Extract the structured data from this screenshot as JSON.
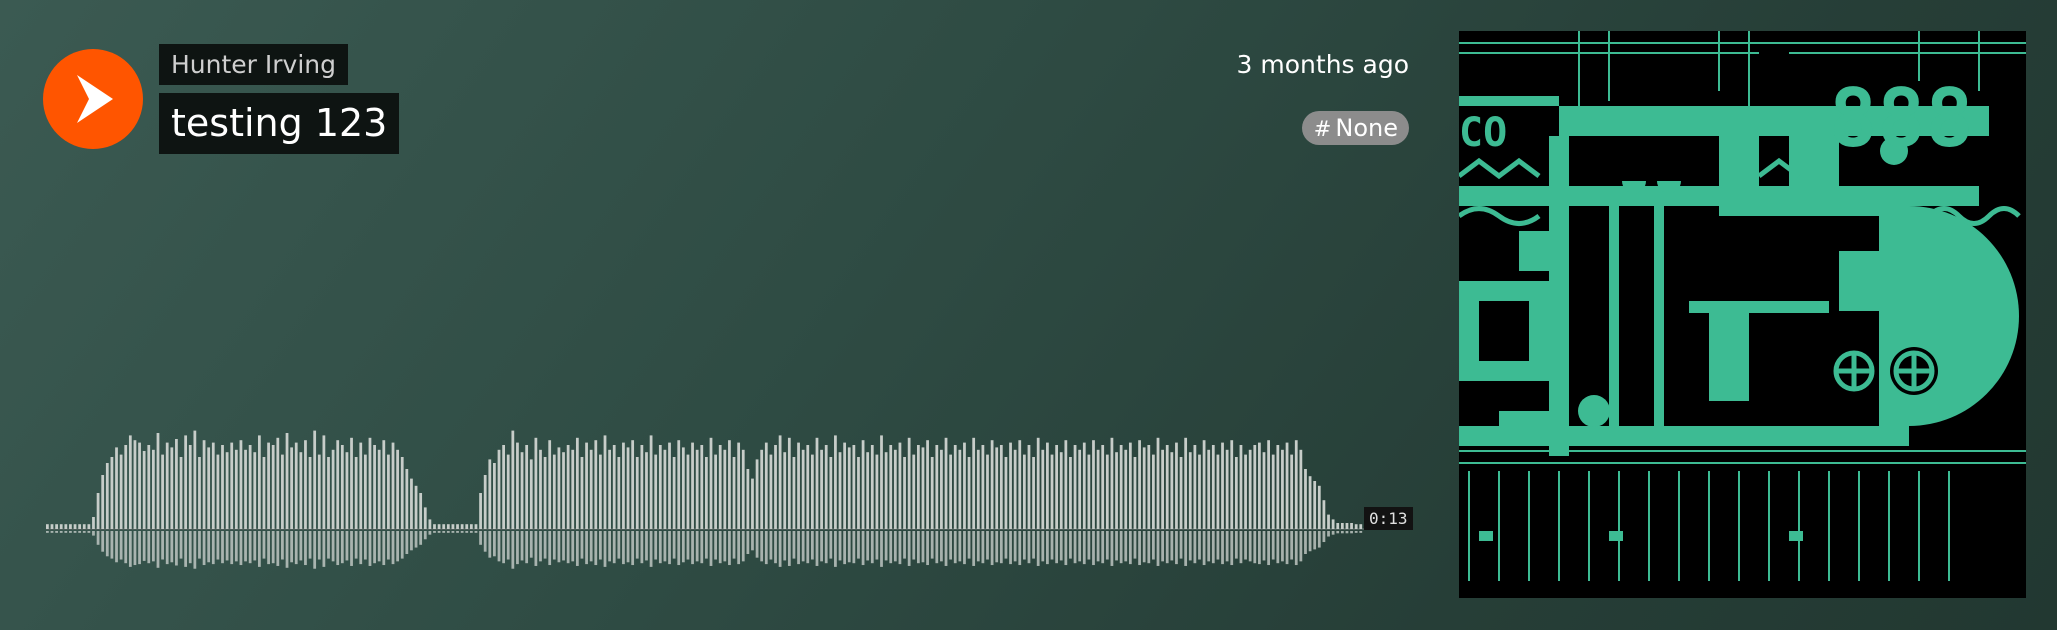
{
  "artist": {
    "name": "Hunter Irving"
  },
  "track": {
    "title": "testing 123",
    "posted": "3 months ago",
    "tag": "None",
    "duration": "0:13"
  },
  "colors": {
    "accent": "#ff5500",
    "waveform": "#c7cdc9",
    "artwork_green": "#3dbb93"
  },
  "icons": {
    "play": "play-icon",
    "tag": "hash-icon"
  },
  "waveform": {
    "played_fraction": 0,
    "amplitudes": [
      0.04,
      0.04,
      0.04,
      0.04,
      0.04,
      0.04,
      0.04,
      0.04,
      0.04,
      0.04,
      0.1,
      0.3,
      0.45,
      0.55,
      0.6,
      0.68,
      0.62,
      0.7,
      0.78,
      0.74,
      0.72,
      0.65,
      0.7,
      0.66,
      0.8,
      0.62,
      0.72,
      0.68,
      0.75,
      0.6,
      0.78,
      0.7,
      0.82,
      0.6,
      0.74,
      0.68,
      0.72,
      0.62,
      0.7,
      0.64,
      0.72,
      0.66,
      0.74,
      0.66,
      0.7,
      0.64,
      0.78,
      0.6,
      0.72,
      0.7,
      0.76,
      0.62,
      0.8,
      0.68,
      0.72,
      0.64,
      0.74,
      0.6,
      0.82,
      0.62,
      0.78,
      0.6,
      0.66,
      0.74,
      0.7,
      0.64,
      0.76,
      0.6,
      0.72,
      0.62,
      0.76,
      0.7,
      0.66,
      0.74,
      0.62,
      0.72,
      0.66,
      0.6,
      0.5,
      0.42,
      0.36,
      0.3,
      0.18,
      0.08,
      0.04,
      0.04,
      0.04,
      0.04,
      0.04,
      0.04,
      0.04,
      0.04,
      0.04,
      0.04,
      0.3,
      0.45,
      0.58,
      0.55,
      0.66,
      0.7,
      0.62,
      0.82,
      0.72,
      0.64,
      0.7,
      0.58,
      0.76,
      0.66,
      0.6,
      0.74,
      0.62,
      0.68,
      0.64,
      0.7,
      0.66,
      0.76,
      0.6,
      0.72,
      0.66,
      0.74,
      0.62,
      0.78,
      0.66,
      0.7,
      0.6,
      0.72,
      0.68,
      0.74,
      0.6,
      0.7,
      0.64,
      0.78,
      0.62,
      0.7,
      0.66,
      0.72,
      0.6,
      0.74,
      0.68,
      0.62,
      0.72,
      0.66,
      0.7,
      0.6,
      0.76,
      0.62,
      0.7,
      0.66,
      0.74,
      0.6,
      0.72,
      0.66,
      0.5,
      0.42,
      0.58,
      0.66,
      0.72,
      0.62,
      0.7,
      0.78,
      0.64,
      0.76,
      0.6,
      0.72,
      0.66,
      0.7,
      0.62,
      0.76,
      0.66,
      0.7,
      0.6,
      0.78,
      0.64,
      0.72,
      0.68,
      0.7,
      0.6,
      0.74,
      0.64,
      0.7,
      0.62,
      0.78,
      0.64,
      0.7,
      0.66,
      0.72,
      0.6,
      0.76,
      0.62,
      0.7,
      0.68,
      0.74,
      0.6,
      0.7,
      0.66,
      0.76,
      0.62,
      0.7,
      0.66,
      0.72,
      0.6,
      0.76,
      0.66,
      0.7,
      0.62,
      0.74,
      0.68,
      0.7,
      0.6,
      0.72,
      0.66,
      0.74,
      0.62,
      0.7,
      0.6,
      0.76,
      0.66,
      0.72,
      0.62,
      0.7,
      0.64,
      0.74,
      0.6,
      0.7,
      0.66,
      0.72,
      0.62,
      0.74,
      0.66,
      0.7,
      0.62,
      0.76,
      0.64,
      0.7,
      0.66,
      0.72,
      0.6,
      0.74,
      0.68,
      0.7,
      0.62,
      0.76,
      0.66,
      0.7,
      0.64,
      0.72,
      0.6,
      0.76,
      0.64,
      0.7,
      0.62,
      0.74,
      0.66,
      0.7,
      0.62,
      0.72,
      0.66,
      0.74,
      0.6,
      0.7,
      0.62,
      0.66,
      0.7,
      0.72,
      0.64,
      0.74,
      0.62,
      0.7,
      0.66,
      0.72,
      0.62,
      0.74,
      0.66,
      0.5,
      0.44,
      0.4,
      0.36,
      0.24,
      0.12,
      0.08,
      0.05,
      0.05,
      0.05,
      0.05,
      0.04,
      0.04
    ]
  }
}
